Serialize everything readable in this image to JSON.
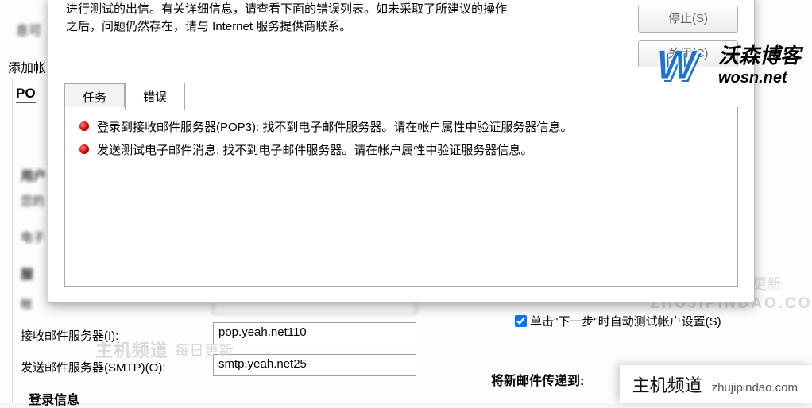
{
  "outer": {
    "top_partial": "息可",
    "add_account": "添加帐",
    "tab_pop": "PO",
    "section_user": "用户",
    "user_sub": "您的",
    "email_label": "电子",
    "section_server": "服",
    "account_label": "帐",
    "incoming_label": "接收邮件服务器(I):",
    "outgoing_label": "发送邮件服务器(SMTP)(O):",
    "section_login": "登录信息"
  },
  "inputs": {
    "account": "",
    "incoming": "pop.yeah.net110",
    "outgoing": "smtp.yeah.net25"
  },
  "right": {
    "checkbox_label": "单击\"下一步\"时自动测试帐户设置(S)",
    "checked": true,
    "deliver": "将新邮件传递到:"
  },
  "dialog": {
    "top_line1": "进行测试的出信。有关详细信息，请查看下面的错误列表。如未采取了所建议的操作",
    "top_line2": "之后，问题仍然存在，请与 Internet 服务提供商联系。",
    "btn_stop": "停止(S)",
    "btn_close": "关闭(C)",
    "tabs": {
      "tasks": "任务",
      "errors": "错误"
    },
    "errors": [
      "登录到接收邮件服务器(POP3): 找不到电子邮件服务器。请在帐户属性中验证服务器信息。",
      "发送测试电子邮件消息: 找不到电子邮件服务器。请在帐户属性中验证服务器信息。"
    ]
  },
  "watermarks": {
    "main": "主机频道",
    "sub": "每日更新",
    "url": "ZHUJIPINDAO.COM"
  },
  "logo": {
    "cn": "沃森博客",
    "en": "wosn.net"
  },
  "brand": {
    "cn": "主机频道",
    "url": "zhujipindao.com"
  }
}
